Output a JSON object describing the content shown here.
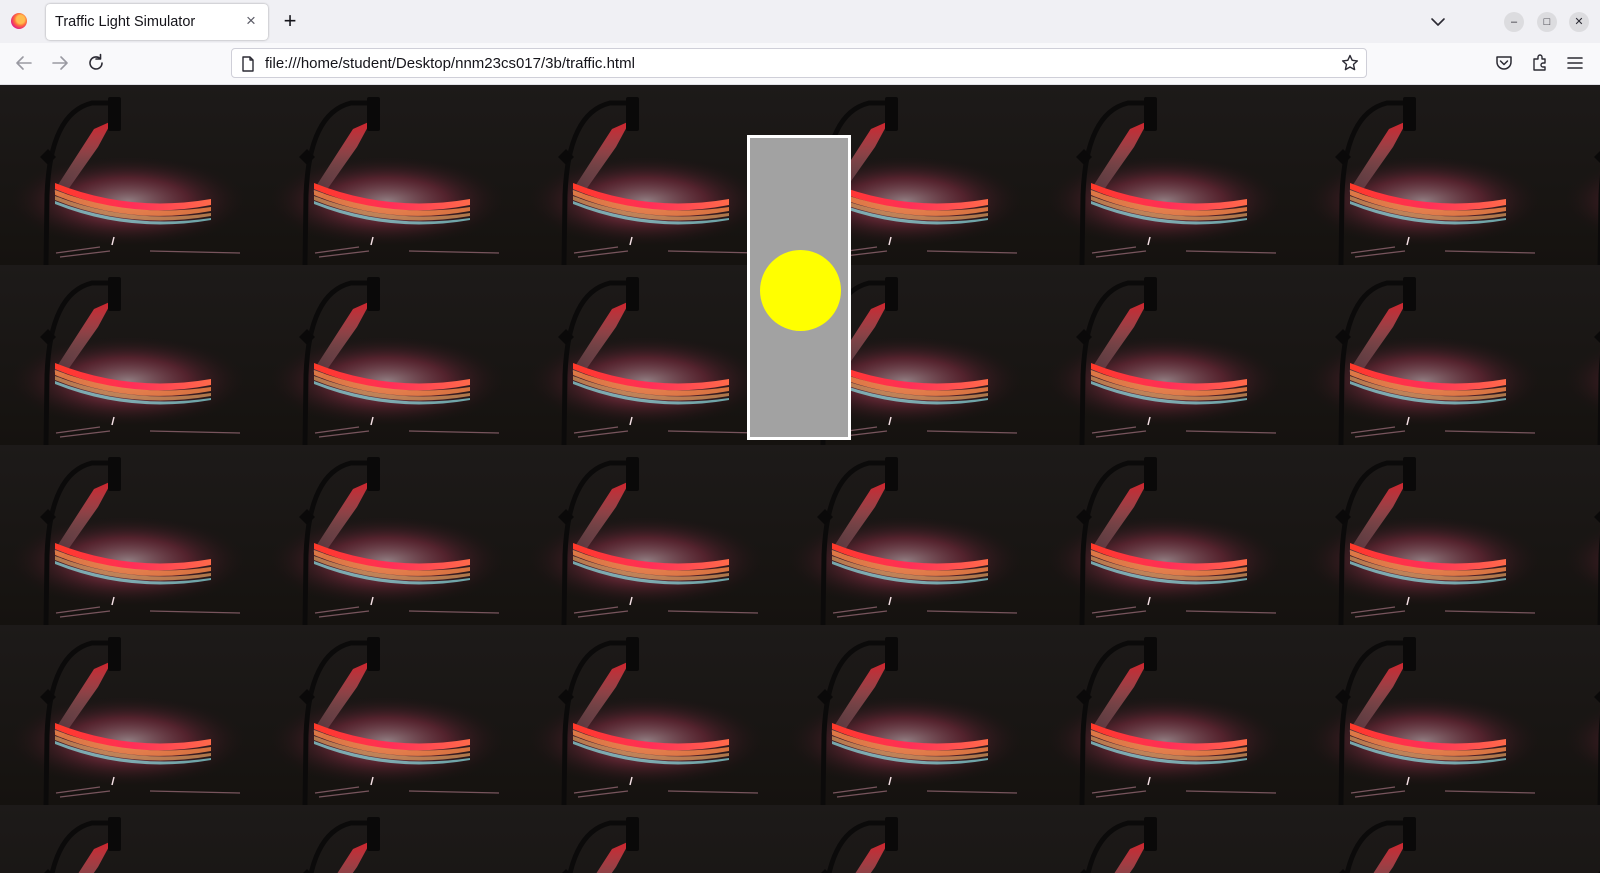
{
  "browser": {
    "tab_title": "Traffic Light Simulator",
    "tab_close_glyph": "×",
    "new_tab_glyph": "+",
    "url": "file:///home/student/Desktop/nnm23cs017/3b/traffic.html",
    "window_controls": {
      "minimize_glyph": "–",
      "maximize_glyph": "□",
      "close_glyph": "✕"
    }
  },
  "page": {
    "background_image": "tiled photo of a traffic light at night with red light streaks",
    "traffic_light": {
      "lit_lamp": "yellow",
      "lit_color": "#ffff00",
      "housing_color": "#a2a2a2"
    }
  },
  "icons": {
    "app": "firefox-icon",
    "back": "back-arrow-icon",
    "forward": "forward-arrow-icon",
    "reload": "reload-icon",
    "page": "page-icon",
    "bookmark": "star-icon",
    "pocket": "pocket-icon",
    "extensions": "extensions-icon",
    "menu": "hamburger-menu-icon",
    "tab_list": "chevron-down-icon"
  }
}
